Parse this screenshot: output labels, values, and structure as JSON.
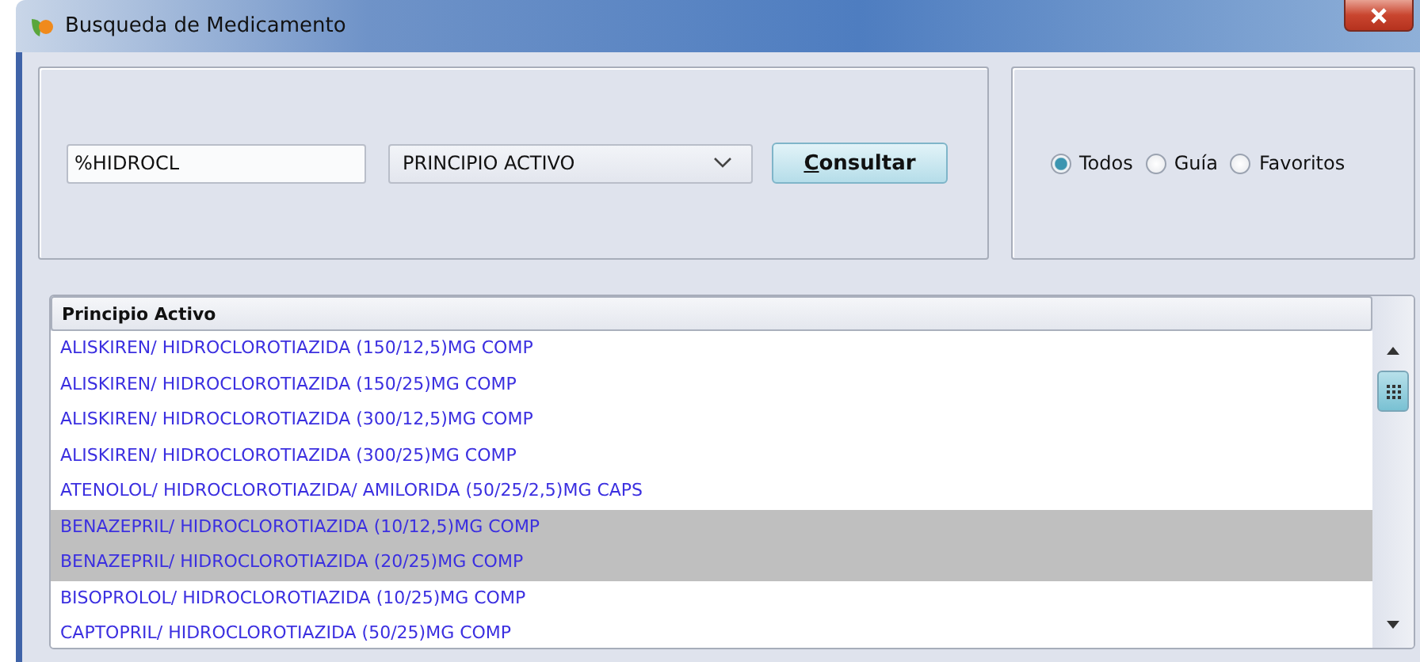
{
  "window": {
    "title": "Busqueda de Medicamento"
  },
  "search": {
    "value": "%HIDROCL"
  },
  "filter_dropdown": {
    "value": "PRINCIPIO ACTIVO"
  },
  "query_button": {
    "label": "Consultar"
  },
  "scope_options": [
    {
      "label": "Todos",
      "selected": true
    },
    {
      "label": "Guía",
      "selected": false
    },
    {
      "label": "Favoritos",
      "selected": false
    }
  ],
  "table": {
    "columns": [
      "Principio Activo"
    ],
    "rows": [
      {
        "text": "ALISKIREN/ HIDROCLOROTIAZIDA (150/12,5)MG COMP",
        "selected": false
      },
      {
        "text": "ALISKIREN/ HIDROCLOROTIAZIDA (150/25)MG COMP",
        "selected": false
      },
      {
        "text": "ALISKIREN/ HIDROCLOROTIAZIDA (300/12,5)MG COMP",
        "selected": false
      },
      {
        "text": "ALISKIREN/ HIDROCLOROTIAZIDA (300/25)MG COMP",
        "selected": false
      },
      {
        "text": "ATENOLOL/ HIDROCLOROTIAZIDA/ AMILORIDA (50/25/2,5)MG CAPS",
        "selected": false
      },
      {
        "text": "BENAZEPRIL/ HIDROCLOROTIAZIDA (10/12,5)MG COMP",
        "selected": true
      },
      {
        "text": "BENAZEPRIL/ HIDROCLOROTIAZIDA (20/25)MG COMP",
        "selected": true
      },
      {
        "text": "BISOPROLOL/ HIDROCLOROTIAZIDA (10/25)MG COMP",
        "selected": false
      },
      {
        "text": "CAPTOPRIL/ HIDROCLOROTIAZIDA (50/25)MG COMP",
        "selected": false
      }
    ]
  }
}
